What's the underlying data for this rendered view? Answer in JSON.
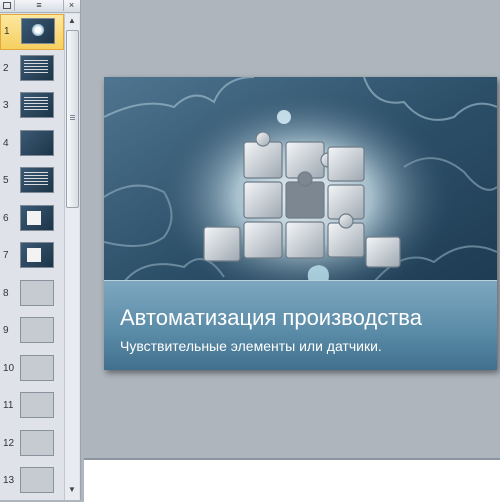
{
  "panel": {
    "tabs": {
      "outline_glyph": "≡",
      "close_glyph": "×"
    },
    "slides": [
      {
        "number": "1",
        "selected": true,
        "kind": "puzzle"
      },
      {
        "number": "2",
        "kind": "photo"
      },
      {
        "number": "3",
        "kind": "text"
      },
      {
        "number": "4",
        "kind": "dark"
      },
      {
        "number": "5",
        "kind": "text"
      },
      {
        "number": "6",
        "kind": "white"
      },
      {
        "number": "7",
        "kind": "white"
      },
      {
        "number": "8",
        "kind": "blank"
      },
      {
        "number": "9",
        "kind": "blank"
      },
      {
        "number": "10",
        "kind": "blank"
      },
      {
        "number": "11",
        "kind": "blank"
      },
      {
        "number": "12",
        "kind": "blank"
      },
      {
        "number": "13",
        "kind": "blank"
      }
    ]
  },
  "scrollbar": {
    "up_glyph": "▲",
    "down_glyph": "▼"
  },
  "slide": {
    "title": "Автоматизация производства",
    "subtitle": "Чувствительные элементы или датчики."
  }
}
